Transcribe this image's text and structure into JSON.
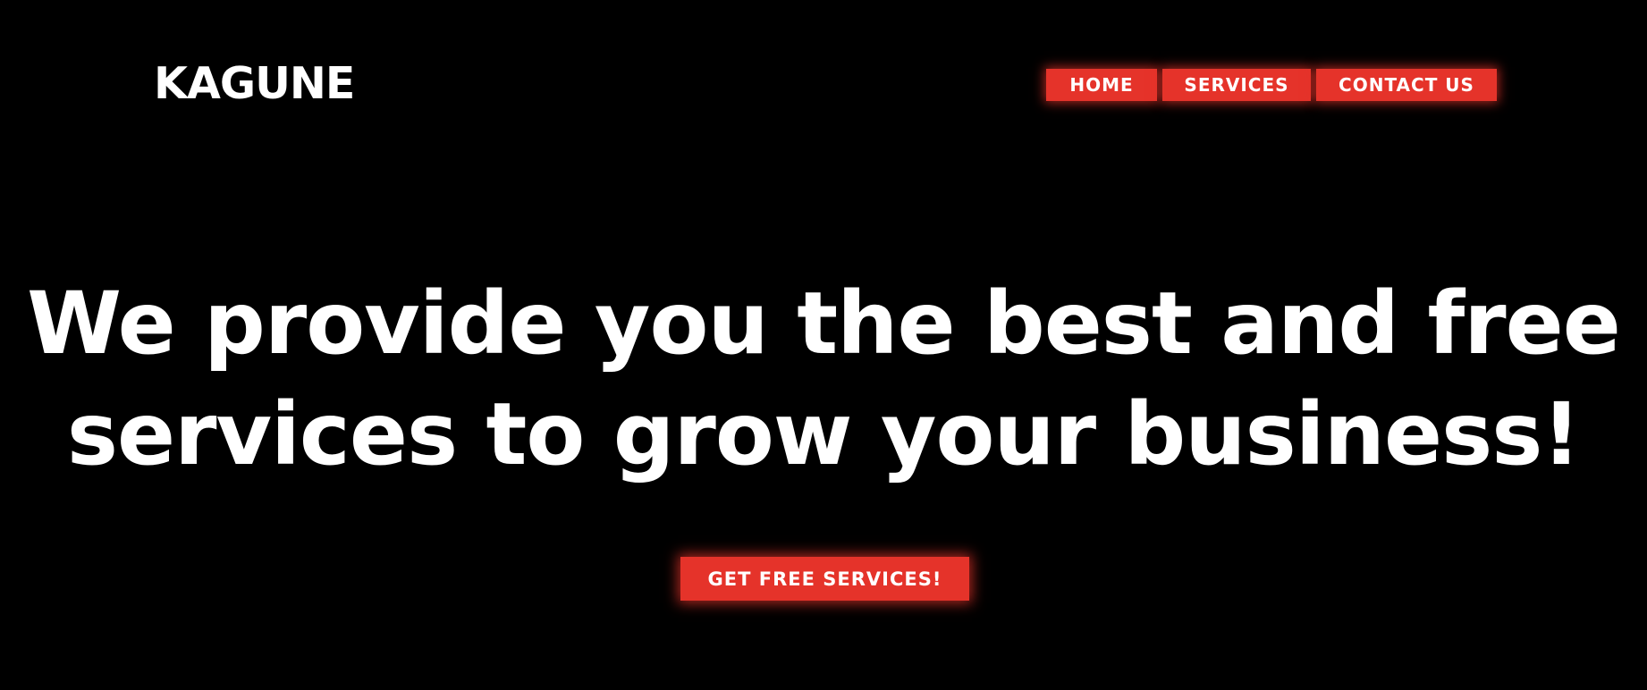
{
  "brand": {
    "name": "KAGUNE",
    "accent_color": "#e5332a",
    "background_color": "#000000",
    "text_color": "#ffffff"
  },
  "nav": {
    "items": [
      {
        "label": "HOME"
      },
      {
        "label": "SERVICES"
      },
      {
        "label": "CONTACT US"
      }
    ]
  },
  "hero": {
    "line1": "We provide you the best and free",
    "line2": "services to grow your business!",
    "cta_label": "GET FREE SERVICES!"
  }
}
